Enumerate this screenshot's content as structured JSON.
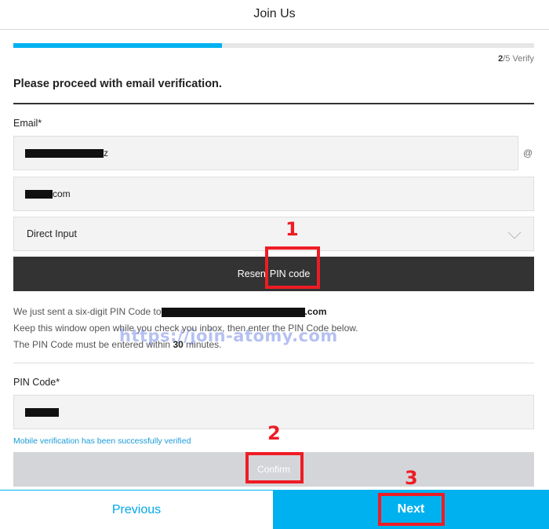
{
  "header": {
    "title": "Join Us"
  },
  "progress": {
    "step_current": "2",
    "step_total_label": "/5 Verify",
    "fraction": 0.4
  },
  "section": {
    "title": "Please proceed with email verification."
  },
  "email": {
    "label": "Email*",
    "local_part_suffix": "z",
    "at_symbol": "@",
    "domain_suffix": "com",
    "domain_select_value": "Direct Input"
  },
  "resend_button": {
    "label_visible_left": "Resen",
    "label_visible_right": "PIN code"
  },
  "info": {
    "line1_prefix": "We just sent a six-digit PIN Code to",
    "line1_suffix": ".com",
    "line2": "Keep this window open while you check you inbox, then enter the PIN Code below.",
    "line3_prefix": "The PIN Code must be entered within",
    "line3_minutes": "30",
    "line3_suffix": "minutes."
  },
  "pin": {
    "label": "PIN Code*"
  },
  "success_message": "Mobile verification has been successfully verified",
  "confirm_button": {
    "label": "Confirm"
  },
  "footer": {
    "previous_label": "Previous",
    "next_label": "Next"
  },
  "annotations": {
    "n1": "1",
    "n2": "2",
    "n3": "3"
  },
  "watermark": "https://join-atomy.com",
  "colors": {
    "accent": "#00b1f0",
    "dark_button": "#333333",
    "callout": "#ee1c24"
  }
}
